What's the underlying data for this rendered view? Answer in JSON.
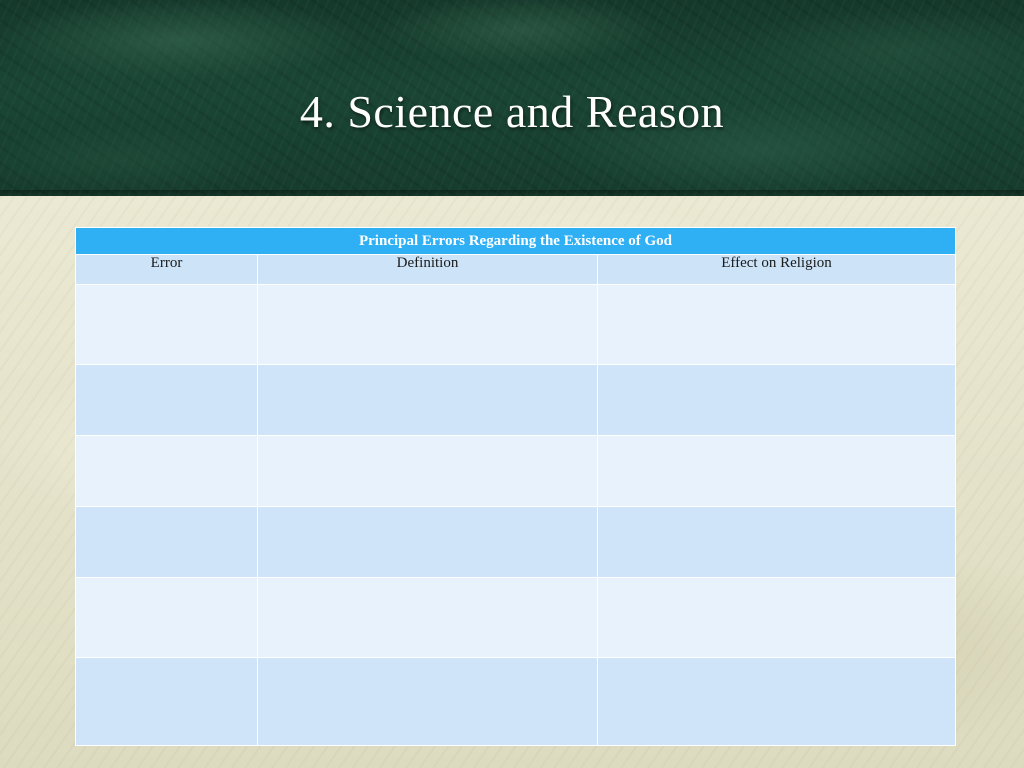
{
  "slide": {
    "title": "4. Science and Reason"
  },
  "table": {
    "caption": "Principal Errors Regarding the Existence of God",
    "columns": [
      "Error",
      "Definition",
      "Effect on Religion"
    ],
    "rows": [
      [
        "",
        "",
        ""
      ],
      [
        "",
        "",
        ""
      ],
      [
        "",
        "",
        ""
      ],
      [
        "",
        "",
        ""
      ],
      [
        "",
        "",
        ""
      ],
      [
        "",
        "",
        ""
      ]
    ]
  },
  "colors": {
    "header_band": "#163c2d",
    "table_title_bg": "#2fb0f5",
    "table_header_bg": "#cde3f8",
    "row_light": "#e8f2fd",
    "row_dark": "#d0e4f9"
  }
}
